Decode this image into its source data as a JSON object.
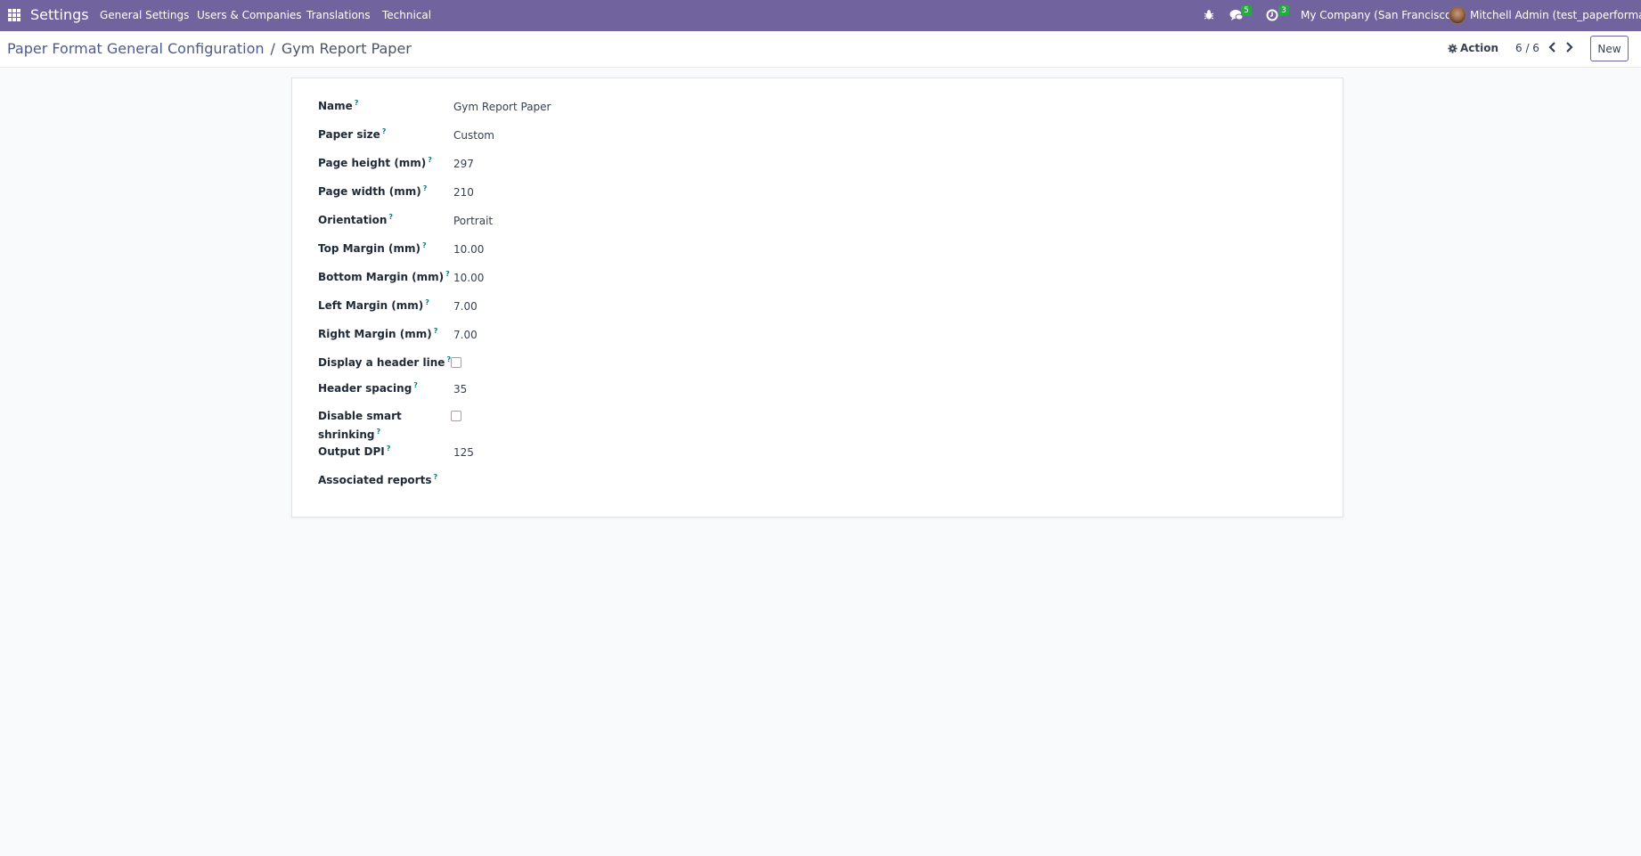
{
  "navbar": {
    "app_name": "Settings",
    "menu": [
      "General Settings",
      "Users & Companies",
      "Translations",
      "Technical"
    ],
    "icons": {
      "apps": "apps-grid-icon",
      "debug": "bug-icon",
      "messages": "chat-icon",
      "activities": "clock-icon"
    },
    "messages_count": "5",
    "activities_count": "3",
    "company": "My Company (San Francisco)",
    "user": "Mitchell Admin (test_paperformat)",
    "badge_color": "#28a745",
    "bar_color": "#71639e"
  },
  "control_panel": {
    "breadcrumb_parent": "Paper Format General Configuration",
    "breadcrumb_separator": "/",
    "breadcrumb_current": "Gym Report Paper",
    "action_label": "Action",
    "pager": "6 / 6",
    "new_label": "New"
  },
  "form": {
    "help_mark": "?",
    "fields": [
      {
        "label": "Name",
        "value": "Gym Report Paper"
      },
      {
        "label": "Paper size",
        "value": "Custom"
      },
      {
        "label": "Page height (mm)",
        "value": "297"
      },
      {
        "label": "Page width (mm)",
        "value": "210"
      },
      {
        "label": "Orientation",
        "value": "Portrait"
      },
      {
        "label": "Top Margin (mm)",
        "value": "10.00"
      },
      {
        "label": "Bottom Margin (mm)",
        "value": "10.00"
      },
      {
        "label": "Left Margin (mm)",
        "value": "7.00"
      },
      {
        "label": "Right Margin (mm)",
        "value": "7.00"
      },
      {
        "label": "Display a header line",
        "checked": false
      },
      {
        "label": "Header spacing",
        "value": "35"
      },
      {
        "label_line1": "Disable smart",
        "label_line2": "shrinking",
        "checked": false
      },
      {
        "label": "Output DPI",
        "value": "125"
      },
      {
        "label": "Associated reports",
        "value": ""
      }
    ]
  }
}
